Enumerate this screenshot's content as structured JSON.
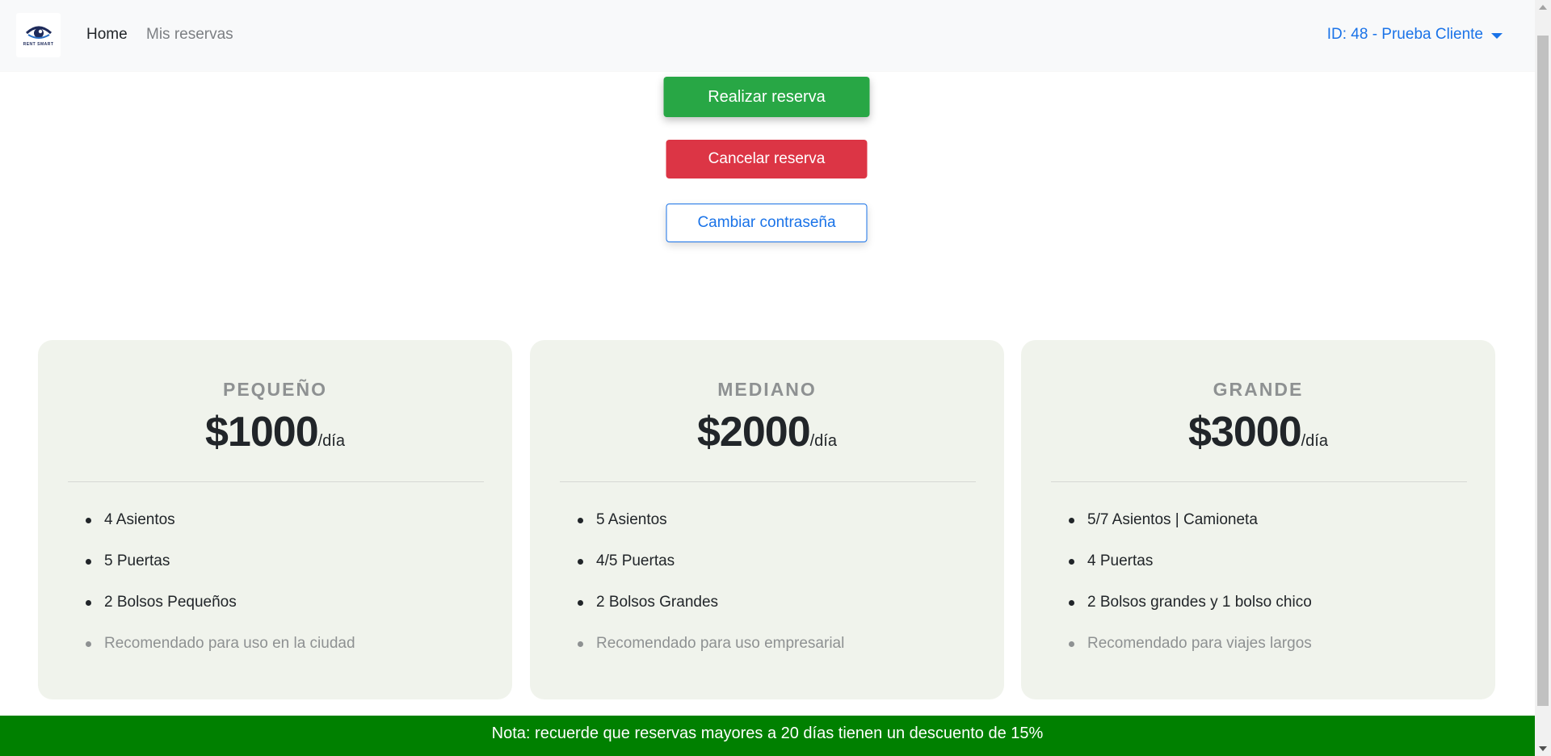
{
  "navbar": {
    "logo_text": "RENT SMART",
    "links": [
      "Home",
      "Mis reservas"
    ],
    "user_label": "ID: 48 - Prueba Cliente"
  },
  "actions": {
    "reserve_label": "Realizar reserva",
    "cancel_label": "Cancelar reserva",
    "password_label": "Cambiar contraseña"
  },
  "plans": [
    {
      "title": "PEQUEÑO",
      "price": "$1000",
      "unit": "/día",
      "features": [
        "4 Asientos",
        "5 Puertas",
        "2 Bolsos Pequeños"
      ],
      "recommendation": "Recomendado para uso en la ciudad"
    },
    {
      "title": "MEDIANO",
      "price": "$2000",
      "unit": "/día",
      "features": [
        "5 Asientos",
        "4/5 Puertas",
        "2 Bolsos Grandes"
      ],
      "recommendation": "Recomendado para uso empresarial"
    },
    {
      "title": "GRANDE",
      "price": "$3000",
      "unit": "/día",
      "features": [
        "5/7 Asientos | Camioneta",
        "4 Puertas",
        "2 Bolsos grandes y 1 bolso chico"
      ],
      "recommendation": "Recomendado para viajes largos"
    }
  ],
  "footer": {
    "note": "Nota: recuerde que reservas mayores a 20 días tienen un descuento de 15%"
  },
  "colors": {
    "navbar_bg": "#f8f9fa",
    "link_blue": "#1a73e8",
    "success": "#28a745",
    "danger": "#dc3545",
    "card_bg": "#f0f3ec",
    "footer_bg": "#008000"
  }
}
